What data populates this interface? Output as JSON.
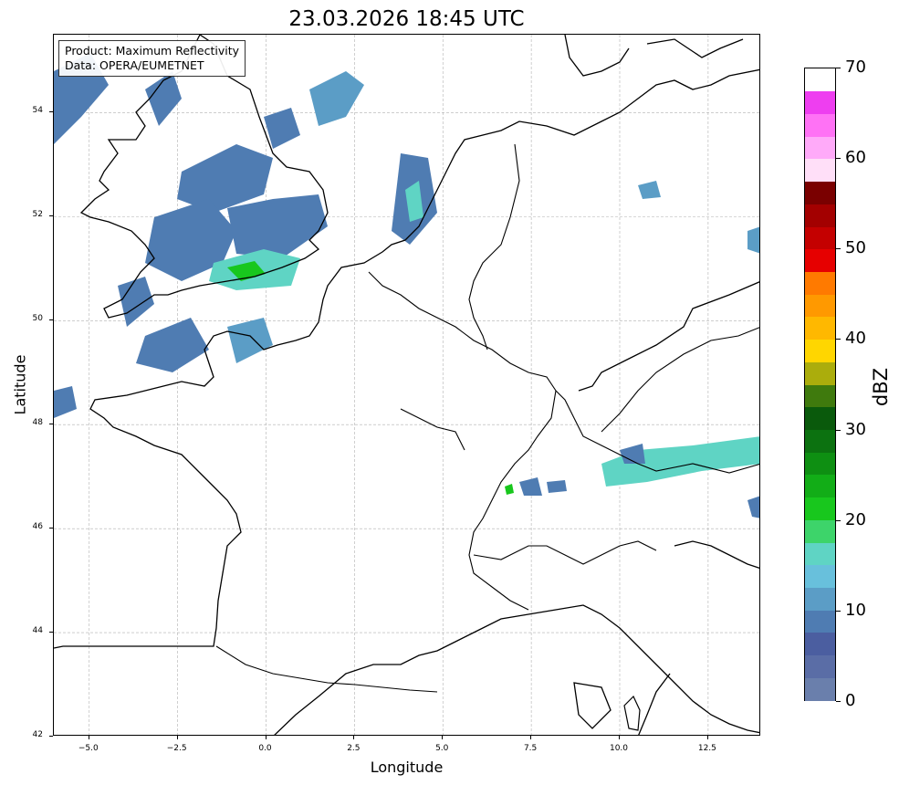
{
  "title": "23.03.2026 18:45 UTC",
  "info": {
    "product": "Product: Maximum Reflectivity",
    "data": "Data: OPERA/EUMETNET"
  },
  "axes": {
    "xlabel": "Longitude",
    "ylabel": "Latitude",
    "xlim": [
      -6,
      14
    ],
    "ylim": [
      42,
      55.5
    ],
    "xticks": [
      "−5.0",
      "−2.5",
      "0.0",
      "2.5",
      "5.0",
      "7.5",
      "10.0",
      "12.5"
    ],
    "xtick_values": [
      -5,
      -2.5,
      0,
      2.5,
      5,
      7.5,
      10,
      12.5
    ],
    "yticks": [
      "42",
      "44",
      "46",
      "48",
      "50",
      "52",
      "54"
    ],
    "ytick_values": [
      42,
      44,
      46,
      48,
      50,
      52,
      54
    ],
    "grid": true
  },
  "colorbar": {
    "label": "dBZ",
    "ticks": [
      "0",
      "10",
      "20",
      "30",
      "40",
      "50",
      "60",
      "70"
    ],
    "tick_values": [
      0,
      10,
      20,
      30,
      40,
      50,
      60,
      70
    ],
    "min": 0,
    "max": 70,
    "step": 2.5,
    "colors": [
      "#6a7fac",
      "#5a6da6",
      "#4b5ea0",
      "#4f7cb2",
      "#5b9dc6",
      "#68c0dc",
      "#5fd4c4",
      "#3dd46a",
      "#18c71d",
      "#12ad17",
      "#0e8f12",
      "#0c7210",
      "#0a5a0c",
      "#3f7a0d",
      "#abad0c",
      "#ffd600",
      "#ffb800",
      "#ff9900",
      "#ff7a00",
      "#e60000",
      "#c40000",
      "#a30000",
      "#7a0000",
      "#ffdff8",
      "#ffaaf9",
      "#ff72f5",
      "#ee3ef0"
    ]
  },
  "map_layers": [
    "coastlines",
    "country-borders",
    "radar-reflectivity"
  ],
  "colors": {
    "land_outline": "#000000",
    "grid": "#b0b0b0",
    "precip_light": "#4f7cb2",
    "precip_medium": "#5fd4c4",
    "precip_heavy": "#18c71d"
  }
}
